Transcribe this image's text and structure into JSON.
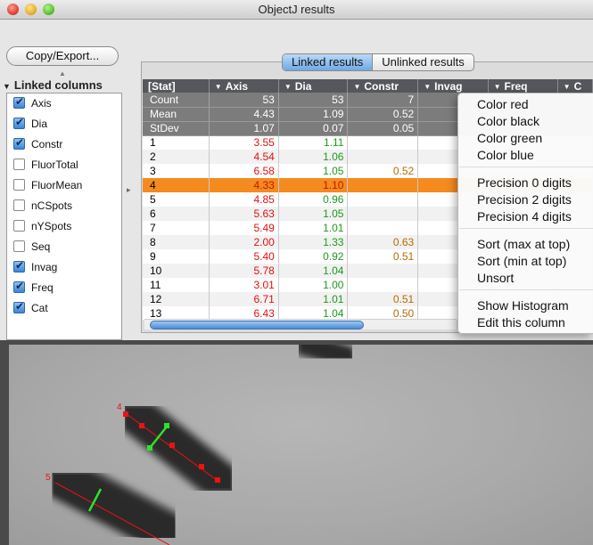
{
  "window": {
    "title": "ObjectJ results"
  },
  "left_panel": {
    "copy_export_label": "Copy/Export...",
    "section_title": "Linked columns",
    "columns": [
      {
        "name": "Axis",
        "checked": true
      },
      {
        "name": "Dia",
        "checked": true
      },
      {
        "name": "Constr",
        "checked": true
      },
      {
        "name": "FluorTotal",
        "checked": false
      },
      {
        "name": "FluorMean",
        "checked": false
      },
      {
        "name": "nCSpots",
        "checked": false
      },
      {
        "name": "nYSpots",
        "checked": false
      },
      {
        "name": "Seq",
        "checked": false
      },
      {
        "name": "Invag",
        "checked": true
      },
      {
        "name": "Freq",
        "checked": true
      },
      {
        "name": "Cat",
        "checked": true
      }
    ]
  },
  "tabs": [
    {
      "label": "Linked results",
      "active": true
    },
    {
      "label": "Unlinked results",
      "active": false
    }
  ],
  "table": {
    "headers": [
      "[Stat]",
      "Axis",
      "Dia",
      "Constr",
      "Invag",
      "Freq",
      "C"
    ],
    "stat_rows": [
      [
        "Count",
        "53",
        "53",
        "7",
        "",
        "",
        ""
      ],
      [
        "Mean",
        "4.43",
        "1.09",
        "0.52",
        "",
        "",
        ""
      ],
      [
        "StDev",
        "1.07",
        "0.07",
        "0.05",
        "",
        "",
        ""
      ]
    ],
    "rows": [
      [
        "1",
        "3.55",
        "1.11",
        "",
        "",
        "",
        ""
      ],
      [
        "2",
        "4.54",
        "1.06",
        "",
        "",
        "",
        ""
      ],
      [
        "3",
        "6.58",
        "1.05",
        "0.52",
        "",
        "",
        ""
      ],
      [
        "4",
        "4.33",
        "1.10",
        "",
        "",
        "",
        ""
      ],
      [
        "5",
        "4.85",
        "0.96",
        "",
        "",
        "",
        ""
      ],
      [
        "6",
        "5.63",
        "1.05",
        "",
        "",
        "",
        ""
      ],
      [
        "7",
        "5.49",
        "1.01",
        "",
        "",
        "",
        ""
      ],
      [
        "8",
        "2.00",
        "1.33",
        "0.63",
        "",
        "",
        ""
      ],
      [
        "9",
        "5.40",
        "0.92",
        "0.51",
        "",
        "",
        ""
      ],
      [
        "10",
        "5.78",
        "1.04",
        "",
        "",
        "",
        ""
      ],
      [
        "11",
        "3.01",
        "1.00",
        "",
        "",
        "",
        ""
      ],
      [
        "12",
        "6.71",
        "1.01",
        "0.51",
        "",
        "",
        ""
      ],
      [
        "13",
        "6.43",
        "1.04",
        "0.50",
        "",
        "",
        ""
      ]
    ],
    "selected_row": 3,
    "column_colors": [
      "",
      "red",
      "green",
      "orange",
      "",
      "",
      ""
    ]
  },
  "context_menu": {
    "groups": [
      [
        "Color red",
        "Color black",
        "Color green",
        "Color blue"
      ],
      [
        "Precision 0 digits",
        "Precision 2 digits",
        "Precision 4 digits"
      ],
      [
        "Sort (max at top)",
        "Sort (min at top)",
        "Unsort"
      ],
      [
        "Show Histogram",
        "Edit this column"
      ]
    ]
  },
  "image": {
    "roi_labels": [
      "4",
      "5"
    ]
  },
  "colors": {
    "selected_row": "#f58a1f",
    "axis_color": "#e01010",
    "dia_color": "#1e9a1e",
    "constr_color": "#b86a00",
    "tab_active": "#6ea8e6"
  }
}
